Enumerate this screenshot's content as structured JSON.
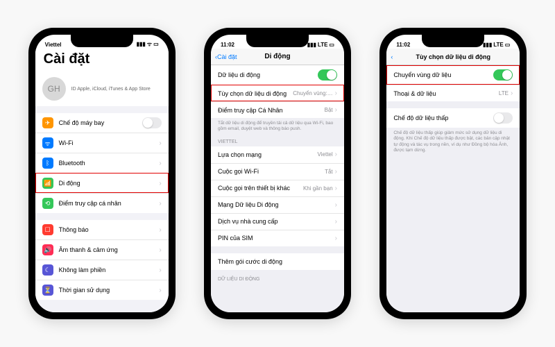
{
  "phone1": {
    "status_left": "Viettel",
    "title": "Cài đặt",
    "avatar_initials": "GH",
    "profile_sub": "ID Apple, iCloud, iTunes & App Store",
    "rows": {
      "airplane": "Chế độ máy bay",
      "wifi": "Wi-Fi",
      "bluetooth": "Bluetooth",
      "cellular": "Di động",
      "hotspot": "Điểm truy cập cá nhân",
      "notifications": "Thông báo",
      "sounds": "Âm thanh & cảm ứng",
      "dnd": "Không làm phiền",
      "screentime": "Thời gian sử dụng"
    }
  },
  "phone2": {
    "status_time": "11:02",
    "status_net": "LTE",
    "back": "Cài đặt",
    "title": "Di động",
    "rows": {
      "mobile_data": "Dữ liệu di động",
      "options": "Tùy chọn dữ liệu di động",
      "options_val": "Chuyển vùng:…",
      "hotspot": "Điểm truy cập Cá Nhân",
      "hotspot_val": "Bật",
      "note": "Tắt dữ liệu di động để truyền tải cả dữ liệu qua Wi-Fi, bao gồm email, duyệt web và thông báo push.",
      "carrier_header": "VIETTEL",
      "network_sel": "Lựa chọn mạng",
      "network_sel_val": "Viettel",
      "wifi_call": "Cuộc gọi Wi-Fi",
      "wifi_call_val": "Tắt",
      "other_call": "Cuộc gọi trên thiết bị khác",
      "other_call_val": "Khi gần bạn",
      "data_net": "Mạng Dữ liệu Di động",
      "provider": "Dịch vụ nhà cung cấp",
      "simpin": "PIN của SIM",
      "add_plan": "Thêm gói cước di động",
      "footer_header": "DỮ LIỆU DI ĐỘNG"
    }
  },
  "phone3": {
    "status_time": "11:02",
    "status_net": "LTE",
    "title": "Tùy chọn dữ liệu di động",
    "rows": {
      "roaming": "Chuyển vùng dữ liệu",
      "voice_data": "Thoại & dữ liệu",
      "voice_data_val": "LTE",
      "lowdata": "Chế độ dữ liệu thấp",
      "note": "Chế độ dữ liệu thấp giúp giảm mức sử dụng dữ liệu di động. Khi Chế độ dữ liệu thấp được bật, các bản cập nhật tự động và tác vụ trong nền, ví dụ như Đồng bộ hóa Ảnh, được tạm dừng."
    }
  }
}
